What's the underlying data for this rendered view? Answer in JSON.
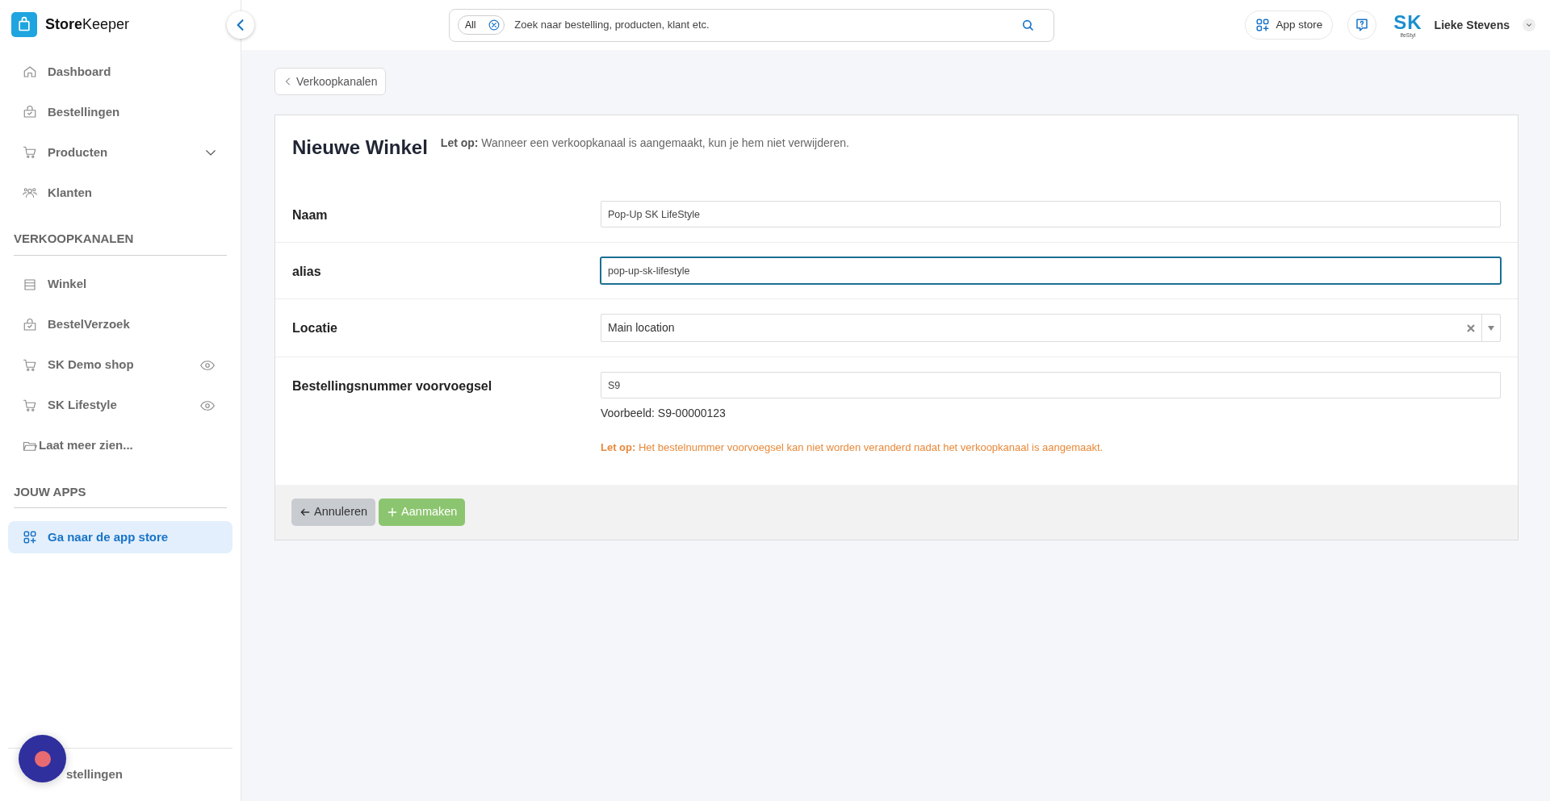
{
  "brand": {
    "bold": "Store",
    "light": "Keeper"
  },
  "sidebar": {
    "nav": [
      {
        "kind": "dashboard",
        "label": "Dashboard",
        "selected": false
      },
      {
        "kind": "orders",
        "label": "Bestellingen",
        "selected": false
      },
      {
        "kind": "products",
        "label": "Producten",
        "selected": false,
        "expandable": true
      },
      {
        "kind": "customers",
        "label": "Klanten",
        "selected": false
      }
    ],
    "sections": [
      {
        "heading": "VERKOOPKANALEN",
        "items": [
          {
            "kind": "store",
            "label": "Winkel",
            "selected": false
          },
          {
            "kind": "orders",
            "label": "BestelVerzoek",
            "selected": false
          },
          {
            "kind": "products",
            "label": "SK Demo shop",
            "selected": false,
            "eye": true
          },
          {
            "kind": "products",
            "label": "SK Lifestyle",
            "selected": false,
            "eye": true
          },
          {
            "kind": "more",
            "label": "Laat meer zien...",
            "selected": false
          }
        ]
      },
      {
        "heading": "JOUW APPS",
        "items": [
          {
            "kind": "apps",
            "label": "Ga naar de app store",
            "selected": true
          }
        ]
      }
    ],
    "footer_item": {
      "label": "stellingen"
    }
  },
  "topbar": {
    "search": {
      "scope": "All",
      "placeholder": "Zoek naar bestelling, producten, klant etc."
    },
    "app_store": "App store",
    "user": {
      "logo_text": "SK",
      "logo_sub": "lfeStyl",
      "name": "Lieke Stevens"
    }
  },
  "breadcrumb": "Verkoopkanalen",
  "form": {
    "title": "Nieuwe Winkel",
    "notice": "**Let op:** Wanneer een verkoopkanaal is aangemaakt, kun je hem niet verwijderen.",
    "rows": [
      {
        "kind": "text",
        "label": "Naam",
        "value": "Pop-Up SK LifeStyle",
        "focused": false
      },
      {
        "kind": "text",
        "label": "alias",
        "value": "pop-up-sk-lifestyle",
        "focused": true
      },
      {
        "kind": "select",
        "label": "Locatie",
        "value": "Main location",
        "focused": false
      },
      {
        "kind": "text_with_hint",
        "label": "Bestellingsnummer voorvoegsel",
        "value": "S9",
        "focused": false,
        "hint": "Voorbeeld: S9-00000123",
        "warning": "**Let op:** Het bestelnummer voorvoegsel kan niet worden veranderd nadat het verkoopkanaal is aangemaakt."
      }
    ],
    "buttons": [
      {
        "kind": "cancel",
        "label": "Annuleren"
      },
      {
        "kind": "create",
        "label": "Aanmaken"
      }
    ]
  }
}
